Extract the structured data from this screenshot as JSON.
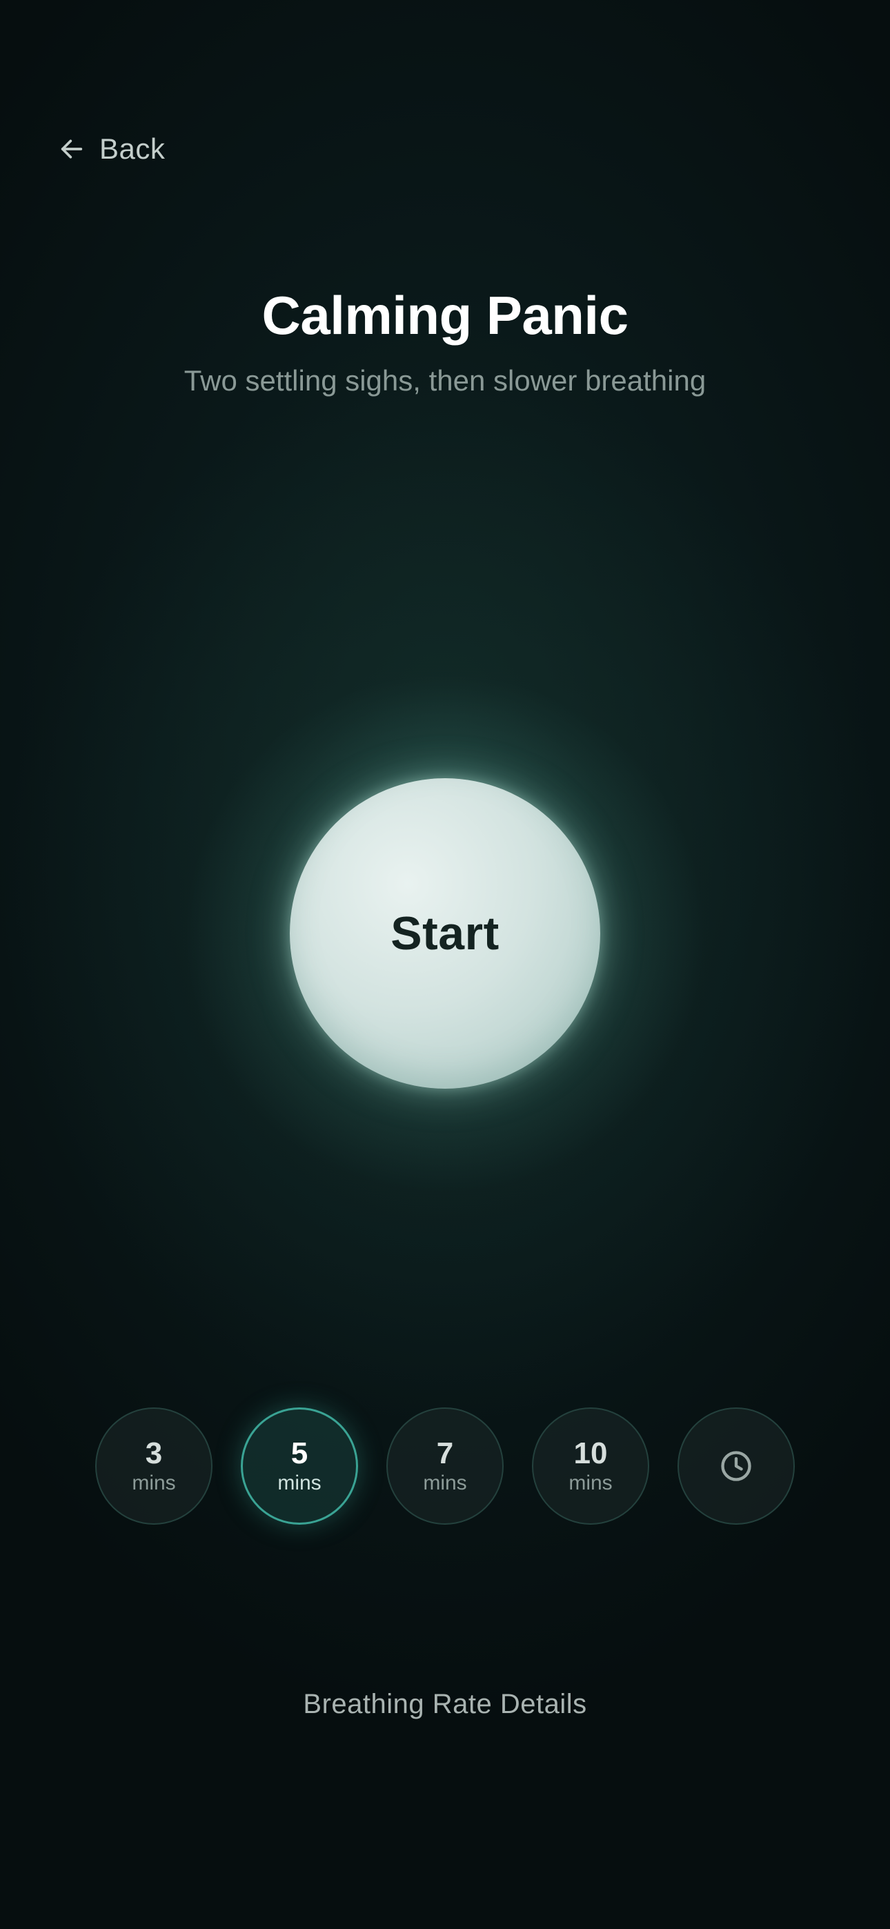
{
  "header": {
    "back_label": "Back",
    "back_icon": "arrow-left-icon"
  },
  "exercise": {
    "title": "Calming Panic",
    "subtitle": "Two settling sighs, then slower breathing"
  },
  "orb": {
    "start_label": "Start"
  },
  "durations": {
    "selected_index": 1,
    "options": [
      {
        "value": "3",
        "unit": "mins"
      },
      {
        "value": "5",
        "unit": "mins"
      },
      {
        "value": "7",
        "unit": "mins"
      },
      {
        "value": "10",
        "unit": "mins"
      }
    ],
    "custom_icon": "clock-icon"
  },
  "footer": {
    "details_label": "Breathing Rate Details"
  },
  "colors": {
    "background": "#071011",
    "accent": "#3aa394",
    "orb": "#d3e3e0",
    "title": "#ffffff",
    "subtitle": "#8a9996"
  }
}
